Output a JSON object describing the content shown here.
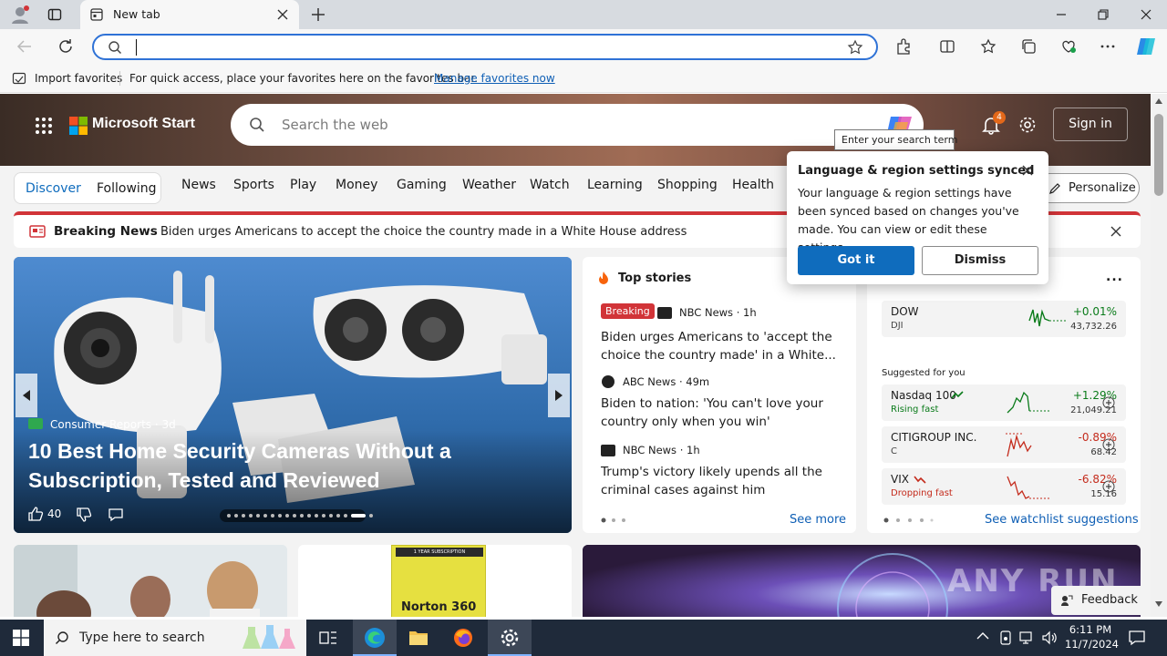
{
  "browser": {
    "tab_title": "New tab",
    "address_value": "",
    "favorites_bar": {
      "import_label": "Import favorites",
      "hint": "For quick access, place your favorites here on the favorites bar.",
      "manage_link": "Manage favorites now"
    }
  },
  "header": {
    "brand": "Microsoft Start",
    "search_placeholder": "Search the web",
    "tooltip": "Enter your search term",
    "notif_count": "4",
    "sign_in": "Sign in"
  },
  "nav": {
    "discover": "Discover",
    "following": "Following",
    "items": [
      "News",
      "Sports",
      "Play",
      "Money",
      "Gaming",
      "Weather",
      "Watch",
      "Learning",
      "Shopping",
      "Health"
    ],
    "personalize": "Personalize"
  },
  "breaking": {
    "label": "Breaking News",
    "text": "Biden urges Americans to accept the choice the country made in a White House address"
  },
  "popup": {
    "title": "Language & region settings synced",
    "body": "Your language & region settings have been synced based on changes you've made. You can view or edit these settings.",
    "got_it": "Got it",
    "dismiss": "Dismiss"
  },
  "hero": {
    "source": "Consumer Reports",
    "age": "3d",
    "title": "10 Best Home Security Cameras Without a Subscription, Tested and Reviewed",
    "likes": "40",
    "slide_count": 19,
    "active_slide": 17
  },
  "top_stories": {
    "heading": "Top stories",
    "breaking_badge": "Breaking",
    "items": [
      {
        "source": "NBC News",
        "age": "1h",
        "title": "Biden urges Americans to 'accept the choice the country made' in a White..."
      },
      {
        "source": "ABC News",
        "age": "49m",
        "title": "Biden to nation: 'You can't love your country only when you win'"
      },
      {
        "source": "NBC News",
        "age": "1h",
        "title": "Trump's victory likely upends all the criminal cases against him"
      }
    ],
    "see_more": "See more"
  },
  "markets": {
    "menu": "...",
    "dow": {
      "name": "DOW",
      "sub": "DJI",
      "pct": "+0.01%",
      "value": "43,732.26"
    },
    "suggested_label": "Suggested for you",
    "suggested": [
      {
        "name": "Nasdaq 100",
        "sub": "Rising fast",
        "pct": "+1.29%",
        "value": "21,049.21",
        "dir": "up"
      },
      {
        "name": "CITIGROUP INC.",
        "sub": "C",
        "pct": "-0.89%",
        "value": "68.42",
        "dir": "down"
      },
      {
        "name": "VIX",
        "sub": "Dropping fast",
        "pct": "-6.82%",
        "value": "15.16",
        "dir": "down"
      }
    ],
    "see_watchlist": "See watchlist suggestions"
  },
  "lower_cards": {
    "norton_box": "Norton 360",
    "norton_top": "1 YEAR SUBSCRIPTION",
    "feedback": "Feedback",
    "watermark": "ANY RUN"
  },
  "taskbar": {
    "search_placeholder": "Type here to search",
    "time": "6:11 PM",
    "date": "11/7/2024"
  },
  "colors": {
    "accent": "#0f6cbd",
    "positive": "#0a7b1a",
    "negative": "#c42b1c",
    "breaking_red": "#d13438"
  }
}
